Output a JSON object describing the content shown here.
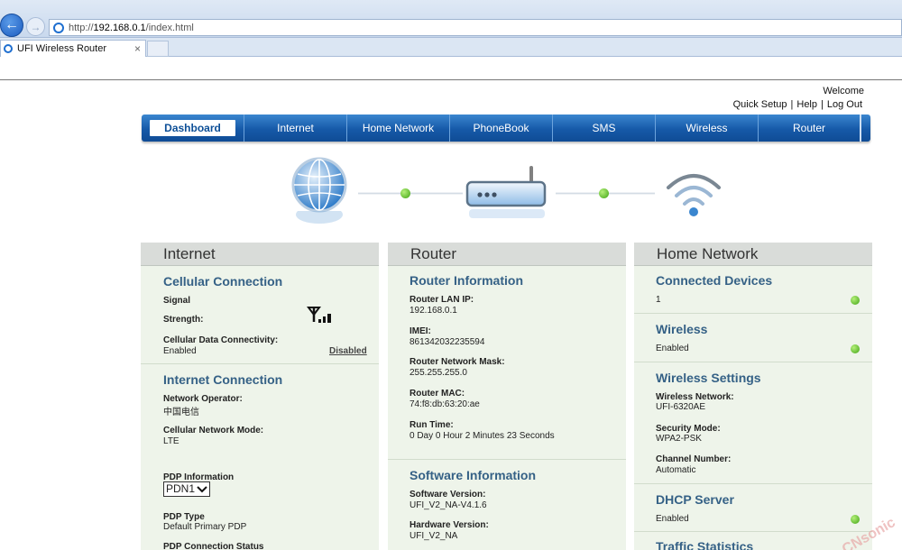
{
  "browser": {
    "url_prefix": "http://",
    "url_host": "192.168.0.1",
    "url_path": "/index.html",
    "tab_title": "UFI Wireless Router",
    "tab_close": "×"
  },
  "header": {
    "welcome": "Welcome",
    "links": [
      "Quick Setup",
      "Help",
      "Log Out"
    ],
    "separator": "|"
  },
  "menu": [
    "Dashboard",
    "Internet",
    "Home Network",
    "PhoneBook",
    "SMS",
    "Wireless",
    "Router"
  ],
  "internet": {
    "title": "Internet",
    "cellular": {
      "title": "Cellular Connection",
      "signal_label": "Signal",
      "strength_label": "Strength:",
      "data_label": "Cellular Data Connectivity:",
      "data_value": "Enabled",
      "toggle_link": "Disabled"
    },
    "connection": {
      "title": "Internet Connection",
      "operator_label": "Network Operator:",
      "operator_value": "中国电信",
      "mode_label": "Cellular Network Mode:",
      "mode_value": "LTE",
      "pdp_label": "PDP Information",
      "pdp_selected": "PDN1",
      "pdp_type_label": "PDP Type",
      "pdp_type_value": "Default Primary PDP",
      "pdp_status_label": "PDP Connection Status"
    }
  },
  "router": {
    "title": "Router",
    "info": {
      "title": "Router Information",
      "lan_ip_label": "Router LAN IP:",
      "lan_ip_value": "192.168.0.1",
      "imei_label": "IMEI:",
      "imei_value": "861342032235594",
      "mask_label": "Router Network Mask:",
      "mask_value": "255.255.255.0",
      "mac_label": "Router MAC:",
      "mac_value": "74:f8:db:63:20:ae",
      "runtime_label": "Run Time:",
      "runtime_value": "0 Day 0 Hour 2 Minutes 23 Seconds"
    },
    "software": {
      "title": "Software Information",
      "sw_label": "Software Version:",
      "sw_value": "UFI_V2_NA-V4.1.6",
      "hw_label": "Hardware Version:",
      "hw_value": "UFI_V2_NA"
    }
  },
  "home_network": {
    "title": "Home Network",
    "devices": {
      "title": "Connected Devices",
      "value": "1"
    },
    "wireless": {
      "title": "Wireless",
      "value": "Enabled"
    },
    "settings": {
      "title": "Wireless Settings",
      "network_label": "Wireless Network:",
      "network_value": "UFI-6320AE",
      "security_label": "Security Mode:",
      "security_value": "WPA2-PSK",
      "channel_label": "Channel Number:",
      "channel_value": "Automatic"
    },
    "dhcp": {
      "title": "DHCP Server",
      "value": "Enabled"
    },
    "traffic": {
      "title": "Traffic Statistics"
    }
  },
  "watermark": "CNsonic",
  "colors": {
    "menu_blue": "#1659a8",
    "status_green": "#3fa314",
    "section_title": "#356186"
  },
  "icons": [
    "back-arrow-icon",
    "forward-arrow-icon",
    "ie-page-icon",
    "globe-icon",
    "router-icon",
    "wifi-icon",
    "signal-strength-icon",
    "status-dot-icon"
  ]
}
